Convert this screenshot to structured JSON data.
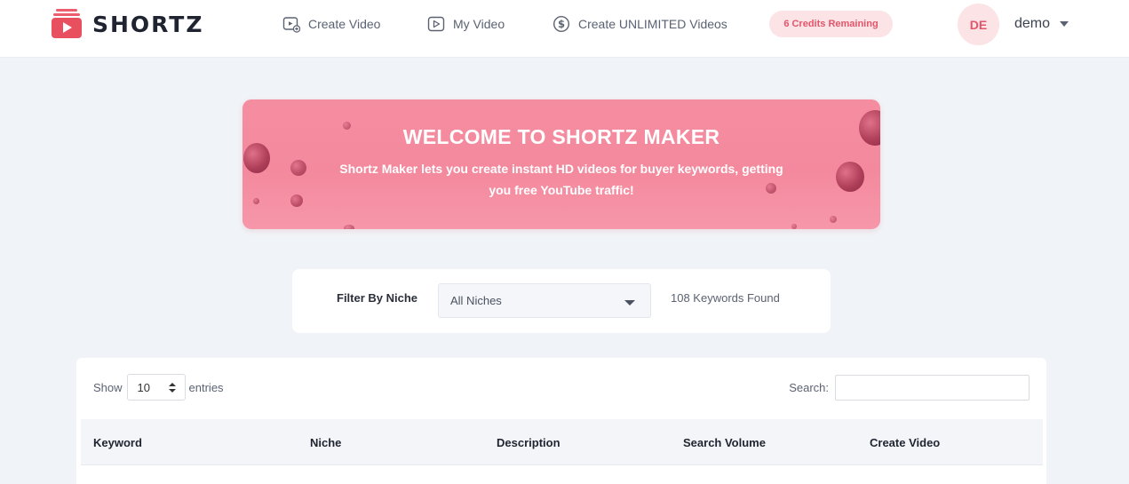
{
  "brand": {
    "name": "SHORTZ"
  },
  "nav": {
    "items": [
      {
        "label": "Create Video",
        "icon": "video-plus-icon"
      },
      {
        "label": "My Video",
        "icon": "video-play-icon"
      },
      {
        "label": "Create UNLIMITED Videos",
        "icon": "dollar-coin-icon"
      }
    ],
    "credits": "6 Credits Remaining",
    "avatar_initials": "DE",
    "username": "demo"
  },
  "banner": {
    "title": "WELCOME TO SHORTZ MAKER",
    "subtitle": "Shortz Maker lets you create instant HD videos for buyer keywords, getting you free YouTube traffic!"
  },
  "filter": {
    "label": "Filter By Niche",
    "selected": "All Niches",
    "result_count": "108 Keywords Found"
  },
  "table": {
    "show_label": "Show",
    "page_length": "10",
    "entries_label": "entries",
    "search_label": "Search:",
    "search_value": "",
    "columns": [
      "Keyword",
      "Niche",
      "Description",
      "Search Volume",
      "Create Video"
    ]
  },
  "colors": {
    "accent": "#e9505f",
    "badge_bg": "#fbe3e6",
    "badge_text": "#e2556a",
    "banner": "#f58da0",
    "page_bg": "#f0f3f7"
  }
}
